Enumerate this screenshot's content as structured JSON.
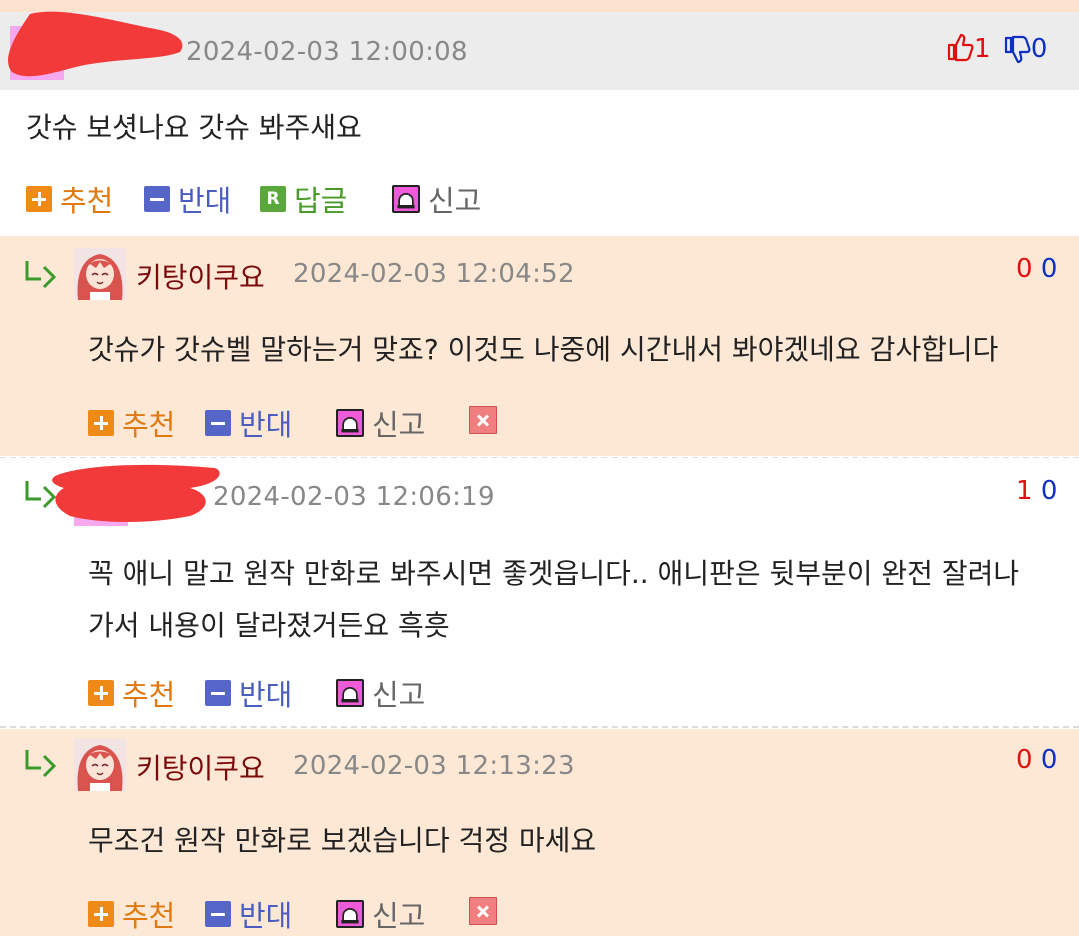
{
  "comments": [
    {
      "timestamp": "2024-02-03 12:00:08",
      "votes": {
        "up": "1",
        "down": "0"
      },
      "body_lines": [
        "갓슈 보셧나요 갓슈 봐주새요"
      ],
      "actions": {
        "recommend": "추천",
        "oppose": "반대",
        "reply": "답글",
        "reply_badge": "R",
        "report": "신고"
      }
    },
    {
      "nickname": "키탕이쿠요",
      "timestamp": "2024-02-03 12:04:52",
      "votes": {
        "up": "0",
        "down": "0"
      },
      "body_lines": [
        "갓슈가 갓슈벨 말하는거 맞죠? 이것도 나중에 시간내서 봐야겠네요 감사합니다"
      ],
      "actions": {
        "recommend": "추천",
        "oppose": "반대",
        "report": "신고"
      }
    },
    {
      "timestamp": "2024-02-03 12:06:19",
      "votes": {
        "up": "1",
        "down": "0"
      },
      "body_lines": [
        "꼭 애니 말고 원작 만화로 봐주시면 좋겟읍니다.. 애니판은 뒷부분이 완전 잘려나",
        "가서 내용이 달라졌거든요 흑흣"
      ],
      "actions": {
        "recommend": "추천",
        "oppose": "반대",
        "report": "신고"
      }
    },
    {
      "nickname": "키탕이쿠요",
      "timestamp": "2024-02-03 12:13:23",
      "votes": {
        "up": "0",
        "down": "0"
      },
      "body_lines": [
        "무조건 원작 만화로 보겠습니다 걱정 마세요"
      ],
      "actions": {
        "recommend": "추천",
        "oppose": "반대",
        "report": "신고"
      }
    }
  ],
  "colors": {
    "reply_bg": "#fde8d6",
    "header_bg": "#ececec",
    "nickname": "#7a0b0b",
    "upvote": "#e01010",
    "downvote": "#1030c0",
    "recommend": "#e07a10",
    "oppose": "#4a5ec0",
    "reply": "#4a9a2a",
    "redaction": "#f23a3a"
  },
  "icons": [
    "thumbs-up-icon",
    "thumbs-down-icon",
    "plus-icon",
    "minus-icon",
    "reply-badge-icon",
    "siren-icon",
    "delete-icon",
    "reply-arrow-icon"
  ]
}
